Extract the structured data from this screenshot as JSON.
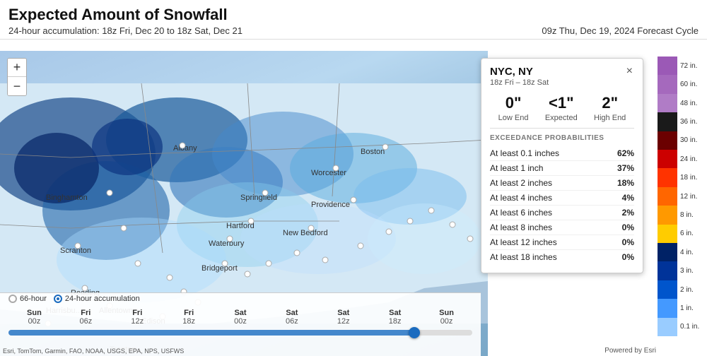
{
  "header": {
    "title": "Expected Amount of Snowfall",
    "accumulation": "24-hour accumulation:  18z Fri, Dec 20  to  18z Sat, Dec 21",
    "forecast_cycle": "09z Thu, Dec 19, 2024 Forecast Cycle"
  },
  "popup": {
    "city": "NYC, NY",
    "time_range": "18z Fri – 18z Sat",
    "low_end_value": "0\"",
    "low_end_label": "Low End",
    "expected_value": "<1\"",
    "expected_label": "Expected",
    "high_end_value": "2\"",
    "high_end_label": "High End",
    "close_label": "×",
    "exceedance_title": "EXCEEDANCE PROBABILITIES",
    "exceedance_rows": [
      {
        "label": "At least 0.1 inches",
        "pct": "62%"
      },
      {
        "label": "At least 1 inch",
        "pct": "37%"
      },
      {
        "label": "At least 2 inches",
        "pct": "18%"
      },
      {
        "label": "At least 4 inches",
        "pct": "4%"
      },
      {
        "label": "At least 6 inches",
        "pct": "2%"
      },
      {
        "label": "At least 8 inches",
        "pct": "0%"
      },
      {
        "label": "At least 12 inches",
        "pct": "0%"
      },
      {
        "label": "At least 18 inches",
        "pct": "0%"
      }
    ]
  },
  "legend": {
    "items": [
      {
        "label": "72 in.",
        "color": "#9b59b6"
      },
      {
        "label": "60 in.",
        "color": "#a569bd"
      },
      {
        "label": "48 in.",
        "color": "#b07cc6"
      },
      {
        "label": "36 in.",
        "color": "#1a1a1a"
      },
      {
        "label": "30 in.",
        "color": "#6b0000"
      },
      {
        "label": "24 in.",
        "color": "#cc0000"
      },
      {
        "label": "18 in.",
        "color": "#ff3300"
      },
      {
        "label": "12 in.",
        "color": "#ff6600"
      },
      {
        "label": "8 in.",
        "color": "#ff9900"
      },
      {
        "label": "6 in.",
        "color": "#ffcc00"
      },
      {
        "label": "4 in.",
        "color": "#002266"
      },
      {
        "label": "3 in.",
        "color": "#003399"
      },
      {
        "label": "2 in.",
        "color": "#0055cc"
      },
      {
        "label": "1 in.",
        "color": "#4499ff"
      },
      {
        "label": "0.1 in.",
        "color": "#99ccff"
      }
    ]
  },
  "timeline": {
    "items": [
      {
        "day": "Sun",
        "hour": "00z"
      },
      {
        "day": "Fri",
        "hour": "06z"
      },
      {
        "day": "Fri",
        "hour": "12z"
      },
      {
        "day": "Fri",
        "hour": "18z"
      },
      {
        "day": "Sat",
        "hour": "00z"
      },
      {
        "day": "Sat",
        "hour": "06z"
      },
      {
        "day": "Sat",
        "hour": "12z"
      },
      {
        "day": "Sat",
        "hour": "18z"
      },
      {
        "day": "Sun",
        "hour": "00z"
      }
    ],
    "thumb_position_pct": 87.5,
    "mode_66h": "66-hour",
    "mode_24h": "24-hour accumulation"
  },
  "map_controls": {
    "zoom_in": "+",
    "zoom_out": "−"
  },
  "attribution": {
    "esri": "Powered by Esri",
    "sources": "Esri, TomTom, Garmin, FAO, NOAA, USGS, EPA, NPS, USFWS"
  }
}
